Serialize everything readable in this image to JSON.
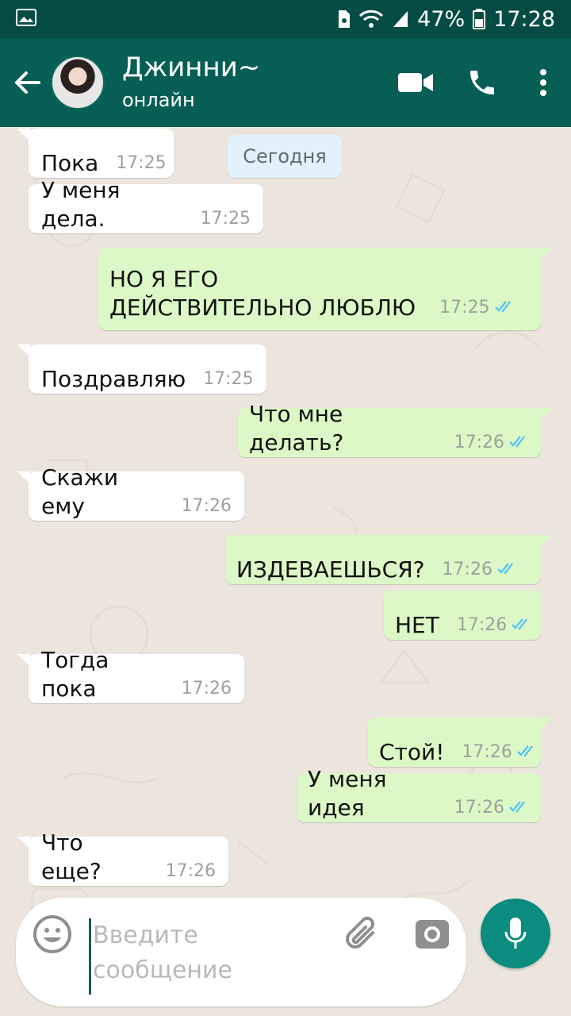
{
  "status_bar": {
    "battery": "47%",
    "time": "17:28"
  },
  "header": {
    "contact_name": "Джинни~",
    "contact_status": "онлайн"
  },
  "date_chip": "Сегодня",
  "messages": [
    {
      "text": "Пока",
      "time": "17:25",
      "direction": "in"
    },
    {
      "text": "У меня дела.",
      "time": "17:25",
      "direction": "in"
    },
    {
      "text": "НО Я ЕГО",
      "text2": "ДЕЙСТВИТЕЛЬНО ЛЮБЛЮ",
      "time": "17:25",
      "direction": "out"
    },
    {
      "text": "Поздравляю",
      "time": "17:25",
      "direction": "in"
    },
    {
      "text": "Что мне делать?",
      "time": "17:26",
      "direction": "out"
    },
    {
      "text": "Скажи ему",
      "time": "17:26",
      "direction": "in"
    },
    {
      "text": "ИЗДЕВАЕШЬСЯ?",
      "time": "17:26",
      "direction": "out"
    },
    {
      "text": "НЕТ",
      "time": "17:26",
      "direction": "out"
    },
    {
      "text": "Тогда пока",
      "time": "17:26",
      "direction": "in"
    },
    {
      "text": "Стой!",
      "time": "17:26",
      "direction": "out"
    },
    {
      "text": "У меня идея",
      "time": "17:26",
      "direction": "out"
    },
    {
      "text": "Что еще?",
      "time": "17:26",
      "direction": "in"
    }
  ],
  "composer": {
    "placeholder": "Введите сообщение"
  },
  "colors": {
    "header": "#075e54",
    "status_bar": "#054d44",
    "outgoing_bubble": "#dcf8c6",
    "incoming_bubble": "#ffffff",
    "accent": "#0a8d7e",
    "read_ticks": "#4fc3f7"
  },
  "icons": [
    "gallery-icon",
    "wifi-icon",
    "signal-icon",
    "battery-icon",
    "back-arrow-icon",
    "video-call-icon",
    "phone-icon",
    "more-vert-icon",
    "double-check-icon",
    "emoji-icon",
    "attach-icon",
    "camera-icon",
    "mic-icon"
  ]
}
